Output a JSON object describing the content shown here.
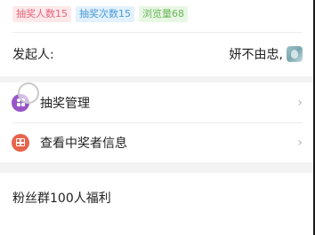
{
  "tags": [
    {
      "label": "抽奖人数15",
      "color": "red"
    },
    {
      "label": "抽奖次数15",
      "color": "blue"
    },
    {
      "label": "浏览量68",
      "color": "green"
    }
  ],
  "initiator": {
    "label": "发起人:",
    "name": "妍不由忠,"
  },
  "menu": [
    {
      "label": "抽奖管理",
      "icon": "grid-icon",
      "chevron": "›"
    },
    {
      "label": "查看中奖者信息",
      "icon": "gift-icon",
      "chevron": "›"
    }
  ],
  "activity": {
    "title": "粉丝群100人福利"
  },
  "colors": {
    "tag_red": "#e2667b",
    "tag_blue": "#4a9bd8",
    "tag_green": "#6ab55a",
    "icon_purple": "#9a55c9",
    "icon_orange": "#e8634c"
  }
}
